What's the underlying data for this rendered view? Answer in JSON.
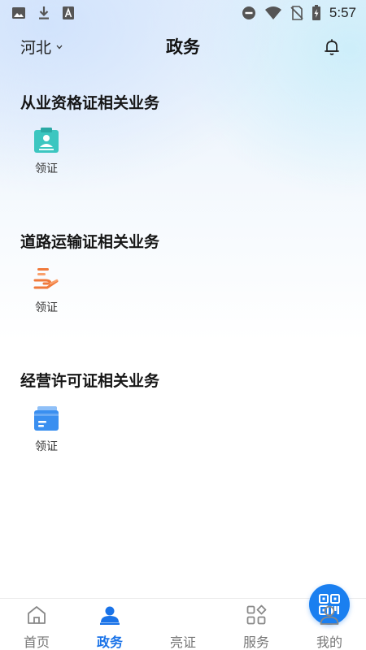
{
  "status_bar": {
    "time": "5:57",
    "left_icons": [
      "image-icon",
      "download-icon",
      "font-a-icon"
    ],
    "right_icons": [
      "do-not-disturb-icon",
      "wifi-icon",
      "no-sim-icon",
      "battery-charging-icon"
    ]
  },
  "header": {
    "region": "河北",
    "title": "政务",
    "notification_icon": "bell-icon"
  },
  "sections": [
    {
      "title": "从业资格证相关业务",
      "item_label": "领证",
      "icon": "certificate-download-icon",
      "color": "#3cc6c0"
    },
    {
      "title": "道路运输证相关业务",
      "item_label": "领证",
      "icon": "hand-receive-icon",
      "color": "#f07a3c"
    },
    {
      "title": "经营许可证相关业务",
      "item_label": "领证",
      "icon": "license-card-icon",
      "color": "#3a8ff0"
    }
  ],
  "bottom_nav": {
    "items": [
      {
        "label": "首页",
        "icon": "home-icon",
        "active": false
      },
      {
        "label": "政务",
        "icon": "person-icon",
        "active": true
      },
      {
        "label": "亮证",
        "icon": "qr-code-icon",
        "active": false
      },
      {
        "label": "服务",
        "icon": "apps-grid-icon",
        "active": false
      },
      {
        "label": "我的",
        "icon": "profile-icon",
        "active": false
      }
    ],
    "active_color": "#1a73e8",
    "fab_color": "#1a7ff0"
  }
}
